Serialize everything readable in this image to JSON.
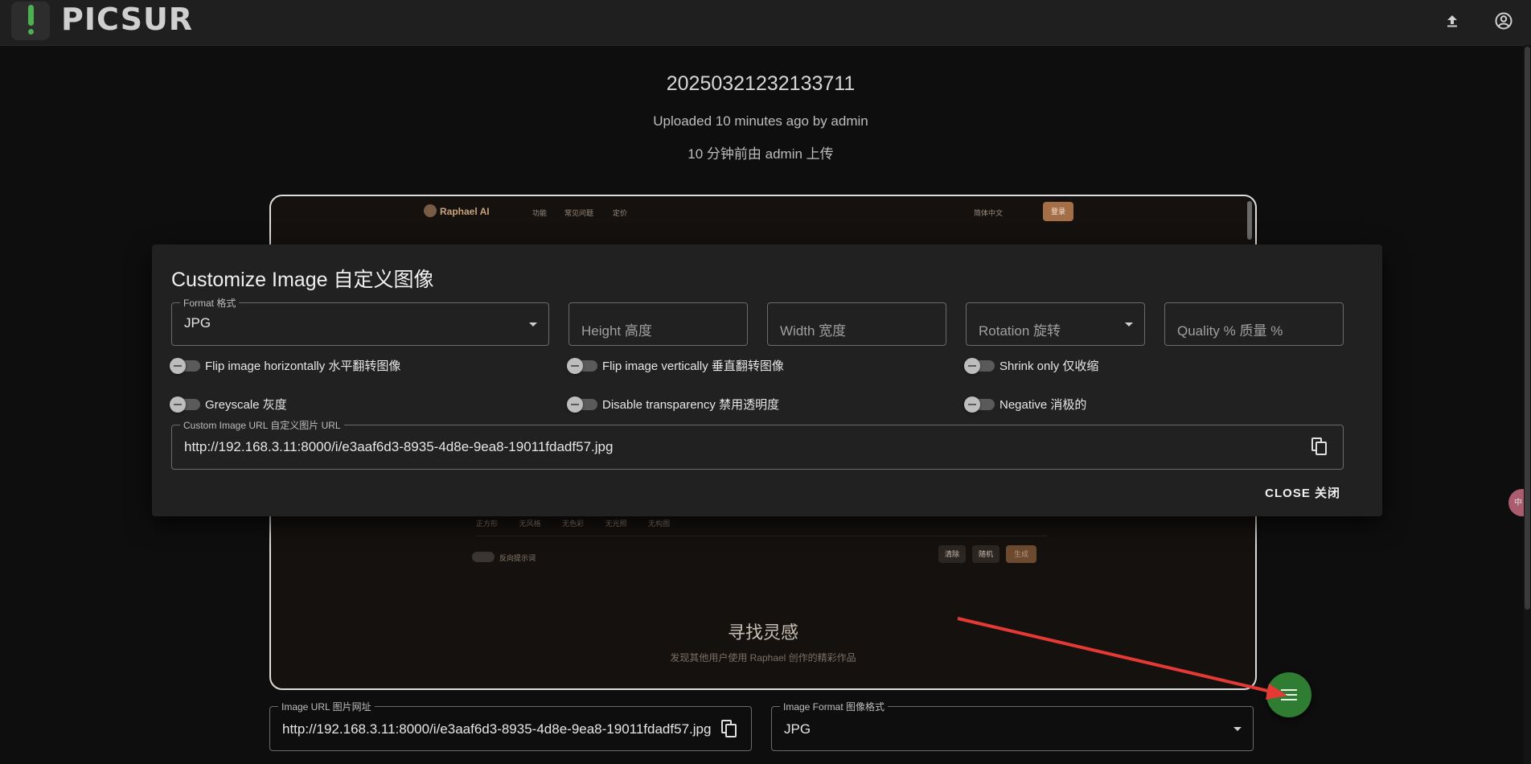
{
  "app": {
    "name": "PICSUR"
  },
  "header": {
    "image_id": "20250321232133711",
    "uploaded_en": "Uploaded 10 minutes ago by admin",
    "uploaded_zh": "10 分钟前由 admin 上传"
  },
  "appbar": {
    "upload_icon": "upload-icon",
    "account_icon": "account-icon"
  },
  "preview": {
    "brand": "Raphael AI",
    "nav": [
      "功能",
      "常见问题",
      "定价"
    ],
    "lang": "简体中文",
    "login": "登录",
    "tags": [
      "正方形",
      "无风格",
      "无色彩",
      "无光照",
      "无构图"
    ],
    "toggle_label": "反向提示词",
    "buttons": [
      "清除",
      "随机",
      "生成"
    ],
    "heading": "寻找灵感",
    "subheading": "发现其他用户使用 Raphael 创作的精彩作品"
  },
  "dialog": {
    "title": "Customize Image  自定义图像",
    "format": {
      "label": "Format  格式",
      "value": "JPG"
    },
    "height": {
      "placeholder": "Height  高度"
    },
    "width": {
      "placeholder": "Width  宽度"
    },
    "rotation": {
      "placeholder": "Rotation  旋转"
    },
    "quality": {
      "placeholder": "Quality %  质量 %"
    },
    "toggles": {
      "flip_h": "Flip image horizontally   水平翻转图像",
      "flip_v": "Flip image vertically   垂直翻转图像",
      "shrink": "Shrink only  仅收缩",
      "grey": "Greyscale  灰度",
      "no_transparency": "Disable transparency   禁用透明度",
      "negative": "Negative  消极的"
    },
    "custom_url": {
      "label": "Custom Image URL  自定义图片 URL",
      "value": "http://192.168.3.11:8000/i/e3aaf6d3-8935-4d8e-9ea8-19011fdadf57.jpg"
    },
    "close_label": "CLOSE  关闭"
  },
  "bottom": {
    "image_url": {
      "label": "Image URL  图片网址",
      "value": "http://192.168.3.11:8000/i/e3aaf6d3-8935-4d8e-9ea8-19011fdadf57.jpg"
    },
    "image_format": {
      "label": "Image Format  图像格式",
      "value": "JPG"
    }
  },
  "side_widget": {
    "label": "中"
  },
  "colors": {
    "accent": "#2e7d32",
    "logo_green": "#4caf50",
    "dialog_bg": "#212121",
    "page_bg": "#0e0e0e"
  }
}
